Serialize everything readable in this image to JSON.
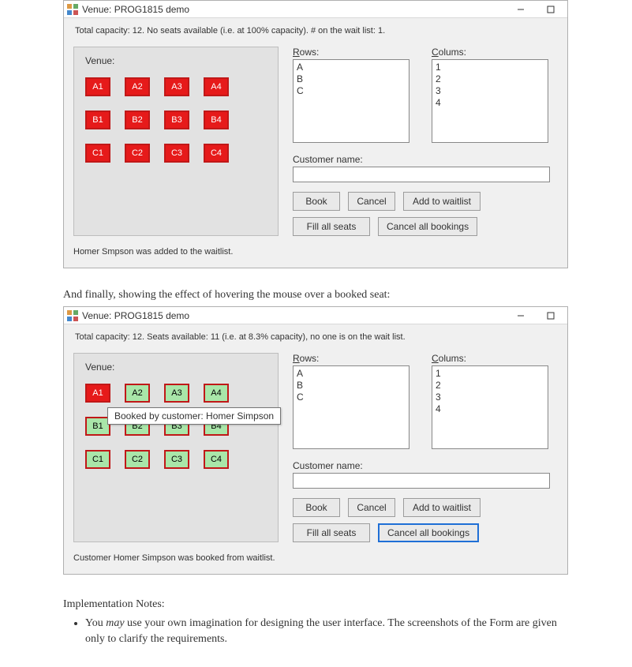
{
  "caption_between": "And finally, showing the effect of hovering the mouse over a booked seat:",
  "window1": {
    "title": "Venue: PROG1815 demo",
    "status": "Total capacity: 12. No seats available (i.e. at 100% capacity). # on the wait list: 1.",
    "venue_label": "Venue:",
    "seats": [
      [
        {
          "label": "A1",
          "state": "booked"
        },
        {
          "label": "A2",
          "state": "booked"
        },
        {
          "label": "A3",
          "state": "booked"
        },
        {
          "label": "A4",
          "state": "booked"
        }
      ],
      [
        {
          "label": "B1",
          "state": "booked"
        },
        {
          "label": "B2",
          "state": "booked"
        },
        {
          "label": "B3",
          "state": "booked"
        },
        {
          "label": "B4",
          "state": "booked"
        }
      ],
      [
        {
          "label": "C1",
          "state": "booked"
        },
        {
          "label": "C2",
          "state": "booked"
        },
        {
          "label": "C3",
          "state": "booked"
        },
        {
          "label": "C4",
          "state": "booked"
        }
      ]
    ],
    "rows_label": "Rows:",
    "cols_label": "Colums:",
    "rows": [
      "A",
      "B",
      "C"
    ],
    "cols": [
      "1",
      "2",
      "3",
      "4"
    ],
    "cust_label": "Customer name:",
    "cust_value": "",
    "buttons": {
      "book": "Book",
      "cancel": "Cancel",
      "add_wait": "Add to waitlist",
      "fill": "Fill all seats",
      "cancel_all": "Cancel all bookings"
    },
    "footer": "Homer Smpson was added to the waitlist."
  },
  "window2": {
    "title": "Venue: PROG1815 demo",
    "status": "Total capacity: 12. Seats available: 11 (i.e. at 8.3% capacity), no one is on the wait list.",
    "venue_label": "Venue:",
    "seats": [
      [
        {
          "label": "A1",
          "state": "booked"
        },
        {
          "label": "A2",
          "state": "free"
        },
        {
          "label": "A3",
          "state": "free"
        },
        {
          "label": "A4",
          "state": "free"
        }
      ],
      [
        {
          "label": "B1",
          "state": "free"
        },
        {
          "label": "B2",
          "state": "free"
        },
        {
          "label": "B3",
          "state": "free"
        },
        {
          "label": "B4",
          "state": "free"
        }
      ],
      [
        {
          "label": "C1",
          "state": "free"
        },
        {
          "label": "C2",
          "state": "free"
        },
        {
          "label": "C3",
          "state": "free"
        },
        {
          "label": "C4",
          "state": "free"
        }
      ]
    ],
    "tooltip": "Booked by customer: Homer Simpson",
    "rows_label": "Rows:",
    "cols_label": "Colums:",
    "rows": [
      "A",
      "B",
      "C"
    ],
    "cols": [
      "1",
      "2",
      "3",
      "4"
    ],
    "cust_label": "Customer name:",
    "cust_value": "",
    "buttons": {
      "book": "Book",
      "cancel": "Cancel",
      "add_wait": "Add to waitlist",
      "fill": "Fill all seats",
      "cancel_all": "Cancel all bookings"
    },
    "footer": "Customer Homer Simpson was booked from waitlist."
  },
  "notes_head": "Implementation Notes:",
  "notes": [
    "You <em>may</em> use your own imagination for designing the user interface. The screenshots of the Form are given only to clarify the requirements."
  ]
}
